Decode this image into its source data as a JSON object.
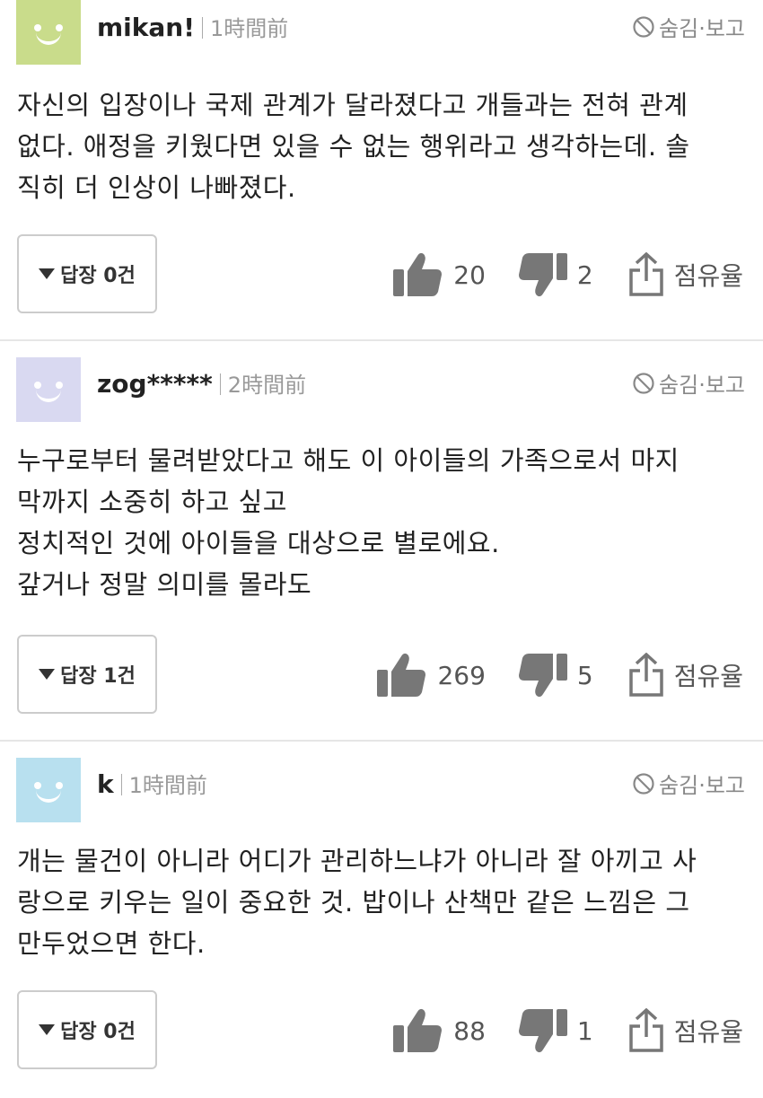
{
  "comments": [
    {
      "username": "mikan!",
      "time": "1時間前",
      "hide_report": "숨김·보고",
      "avatar_color": "#c9dc8b",
      "text": "자신의 입장이나 국제 관계가 달라졌다고 개들과는 전혀 관계\n없다. 애정을 키웠다면 있을 수 없는 행위라고 생각하는데. 솔\n직히 더 인상이 나빠졌다.",
      "reply_label": "답장 0건",
      "likes": "20",
      "dislikes": "2",
      "share_label": "점유율"
    },
    {
      "username": "zog*****",
      "time": "2時間前",
      "hide_report": "숨김·보고",
      "avatar_color": "#d9d9f1",
      "text": "누구로부터 물려받았다고 해도 이 아이들의 가족으로서 마지\n막까지 소중히 하고 싶고\n정치적인 것에 아이들을 대상으로 별로에요.\n갚거나 정말 의미를 몰라도",
      "reply_label": "답장 1건",
      "likes": "269",
      "dislikes": "5",
      "share_label": "점유율"
    },
    {
      "username": "k",
      "time": "1時間前",
      "hide_report": "숨김·보고",
      "avatar_color": "#b8e0ef",
      "text": "개는 물건이 아니라 어디가 관리하느냐가 아니라 잘 아끼고 사\n랑으로 키우는 일이 중요한 것. 밥이나 산책만 같은 느낌은 그\n만두었으면 한다.",
      "reply_label": "답장 0건",
      "likes": "88",
      "dislikes": "1",
      "share_label": "점유율"
    }
  ]
}
